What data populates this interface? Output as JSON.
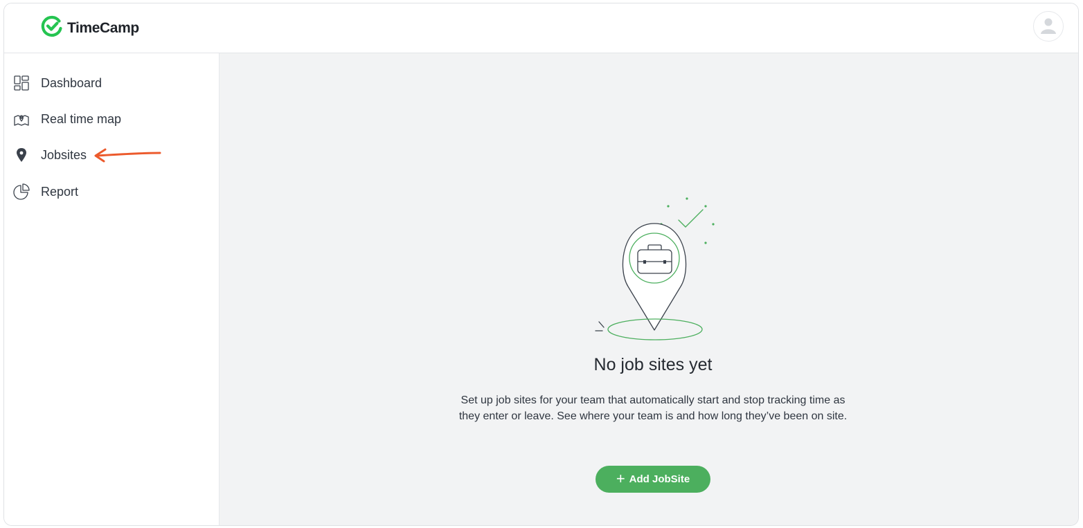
{
  "app": {
    "logo_text": "TimeCamp",
    "brand_color": "#4caf5e"
  },
  "header": {
    "avatar_icon": "user-avatar-icon"
  },
  "sidebar": {
    "items": [
      {
        "label": "Dashboard",
        "icon": "dashboard-grid-icon"
      },
      {
        "label": "Real time map",
        "icon": "map-icon"
      },
      {
        "label": "Jobsites",
        "icon": "location-pin-icon"
      },
      {
        "label": "Report",
        "icon": "pie-chart-icon"
      }
    ],
    "annotation": {
      "icon": "red-arrow-icon",
      "color": "#ec5a2c",
      "points_to": "Jobsites"
    }
  },
  "main": {
    "illustration_icon": "jobsite-pin-briefcase-illustration",
    "empty_title": "No job sites yet",
    "empty_description": "Set up job sites for your team that automatically start and stop tracking time as they enter or leave. See where your team is and how long they’ve been on site.",
    "add_button": {
      "plus": "+",
      "label": "Add JobSite"
    }
  }
}
